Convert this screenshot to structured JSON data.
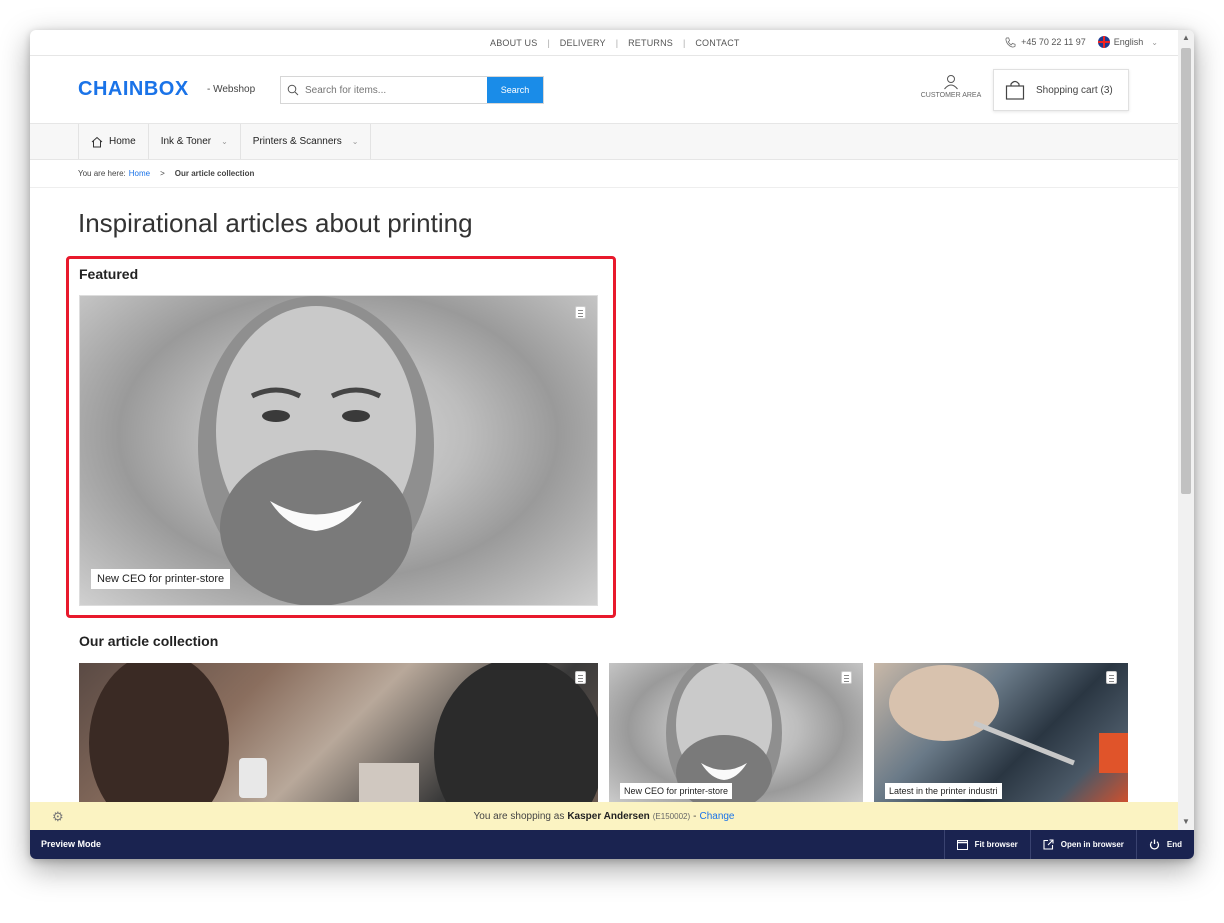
{
  "topbar": {
    "links": [
      "ABOUT US",
      "DELIVERY",
      "RETURNS",
      "CONTACT"
    ],
    "phone": "+45 70 22 11 97",
    "language": "English"
  },
  "header": {
    "logo": "CHAINBOX",
    "subtitle": "- Webshop",
    "search_placeholder": "Search for items...",
    "search_button": "Search",
    "customer_area": "CUSTOMER AREA",
    "cart_label": "Shopping cart (3)"
  },
  "nav": {
    "items": [
      "Home",
      "Ink & Toner",
      "Printers & Scanners"
    ]
  },
  "breadcrumb": {
    "prefix": "You are here:",
    "home": "Home",
    "separator": ">",
    "current": "Our article collection"
  },
  "main": {
    "title": "Inspirational articles about printing",
    "featured_heading": "Featured",
    "featured_caption": "New CEO for printer-store",
    "collection_heading": "Our article collection",
    "cards": [
      {
        "caption": ""
      },
      {
        "caption": "New CEO for printer-store"
      },
      {
        "caption": "Latest in the printer industri"
      }
    ]
  },
  "shopbar": {
    "prefix": "You are shopping as",
    "user": "Kasper Andersen",
    "code": "(E150002)",
    "dash": "-",
    "change": "Change"
  },
  "previewbar": {
    "mode": "Preview Mode",
    "fit": "Fit browser",
    "open": "Open in browser",
    "end": "End"
  },
  "colors": {
    "brand": "#1a73e8",
    "highlight": "#e8192c",
    "preview_bg": "#1a2350",
    "shopbar_bg": "#fbf3c2"
  }
}
